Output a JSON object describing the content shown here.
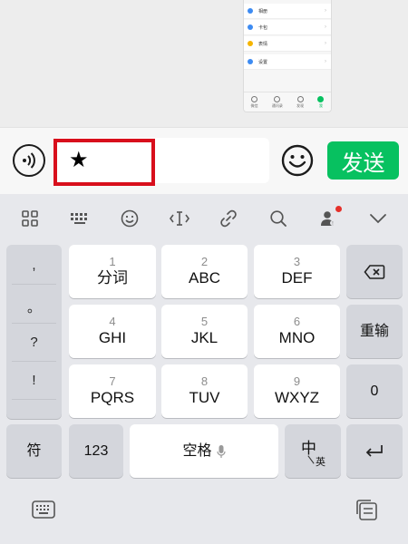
{
  "thumbnail": {
    "menu_items": [
      {
        "label": "相册",
        "color": "#3d8bf2"
      },
      {
        "label": "卡包",
        "color": "#3d8bf2"
      },
      {
        "label": "表情",
        "color": "#f5b400"
      },
      {
        "label": "设置",
        "color": "#3d8bf2"
      }
    ],
    "tabs": [
      {
        "label": "微信",
        "active": false
      },
      {
        "label": "通讯录",
        "active": false
      },
      {
        "label": "发现",
        "active": false
      },
      {
        "label": "我",
        "active": true
      }
    ]
  },
  "input": {
    "value": "★",
    "send_label": "发送"
  },
  "keyboard": {
    "punctuation": [
      ",",
      "。",
      "?",
      "!"
    ],
    "keys": [
      {
        "num": "1",
        "label": "分词"
      },
      {
        "num": "2",
        "label": "ABC"
      },
      {
        "num": "3",
        "label": "DEF"
      },
      {
        "num": "4",
        "label": "GHI"
      },
      {
        "num": "5",
        "label": "JKL"
      },
      {
        "num": "6",
        "label": "MNO"
      },
      {
        "num": "7",
        "label": "PQRS"
      },
      {
        "num": "8",
        "label": "TUV"
      },
      {
        "num": "9",
        "label": "WXYZ"
      }
    ],
    "reinput_label": "重输",
    "zero_label": "0",
    "symbol_label": "符",
    "num_label": "123",
    "space_label": "空格",
    "lang_main": "中",
    "lang_sub": "英"
  },
  "colors": {
    "accent": "#07c160",
    "highlight": "#d80f1c"
  }
}
